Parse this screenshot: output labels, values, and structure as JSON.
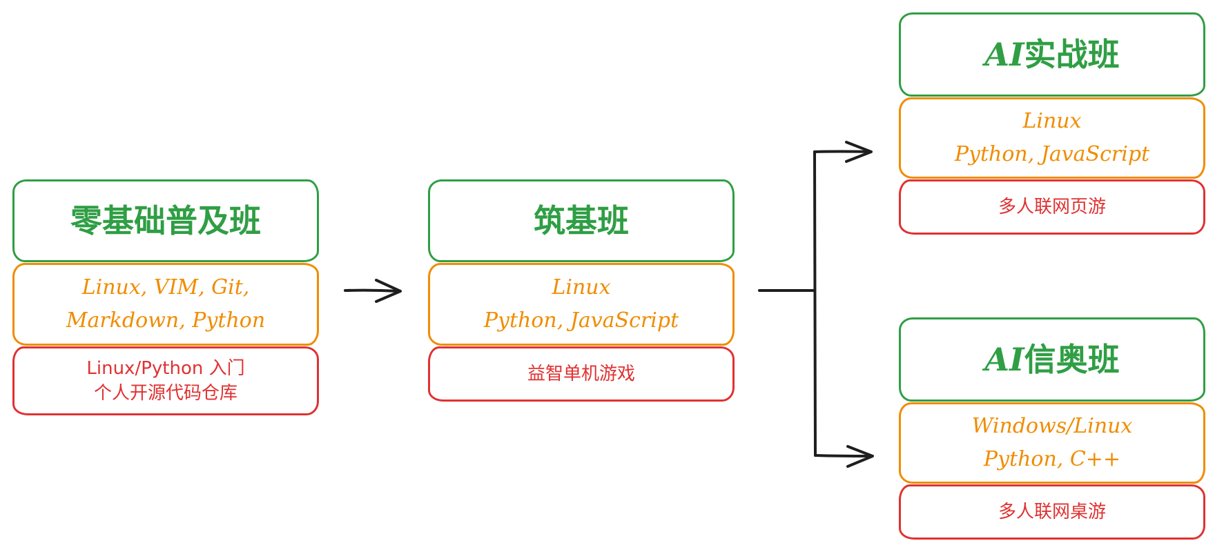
{
  "stages": [
    {
      "id": "zero",
      "title": "零基础普及班",
      "tech": [
        "Linux, VIM, Git,",
        "Markdown, Python"
      ],
      "project": [
        "Linux/Python 入门",
        "个人开源代码仓库"
      ]
    },
    {
      "id": "foundation",
      "title": "筑基班",
      "tech": [
        "Linux",
        "Python, JavaScript"
      ],
      "project": [
        "益智单机游戏"
      ]
    },
    {
      "id": "ai-practice",
      "title_prefix": "AI",
      "title": "实战班",
      "tech": [
        "Linux",
        "Python, JavaScript"
      ],
      "project": [
        "多人联网页游"
      ]
    },
    {
      "id": "ai-olympiad",
      "title_prefix": "AI",
      "title": "信奥班",
      "tech": [
        "Windows/Linux",
        "Python, C++"
      ],
      "project": [
        "多人联网桌游"
      ]
    }
  ],
  "colors": {
    "title": "#2f9e44",
    "tech": "#f08c00",
    "project": "#e03131",
    "arrow": "#1e1e1e"
  }
}
